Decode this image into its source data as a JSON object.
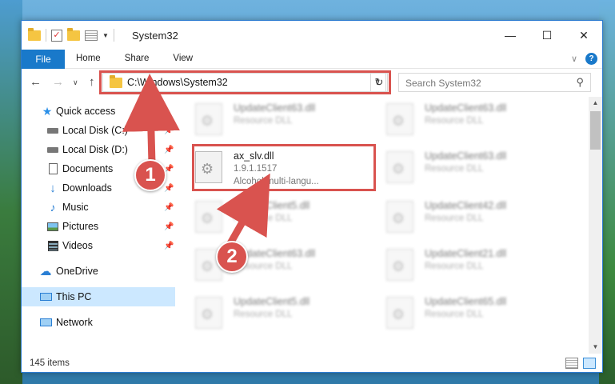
{
  "window": {
    "title": "System32",
    "controls": {
      "minimize": "—",
      "maximize": "☐",
      "close": "✕"
    }
  },
  "ribbon": {
    "file_tab": "File",
    "tabs": [
      "Home",
      "Share",
      "View"
    ]
  },
  "navigation": {
    "address": "C:\\Windows\\System32",
    "search_placeholder": "Search System32"
  },
  "sidebar": {
    "items": [
      {
        "label": "Quick access",
        "icon": "star-icon",
        "pinned": false
      },
      {
        "label": "Local Disk (C:)",
        "icon": "drive-icon",
        "pinned": true
      },
      {
        "label": "Local Disk (D:)",
        "icon": "drive-icon",
        "pinned": true
      },
      {
        "label": "Documents",
        "icon": "documents-icon",
        "pinned": true
      },
      {
        "label": "Downloads",
        "icon": "download-icon",
        "pinned": true
      },
      {
        "label": "Music",
        "icon": "music-icon",
        "pinned": true
      },
      {
        "label": "Pictures",
        "icon": "pictures-icon",
        "pinned": true
      },
      {
        "label": "Videos",
        "icon": "videos-icon",
        "pinned": true
      },
      {
        "label": "OneDrive",
        "icon": "cloud-icon",
        "pinned": false
      },
      {
        "label": "This PC",
        "icon": "computer-icon",
        "pinned": false,
        "selected": true
      },
      {
        "label": "Network",
        "icon": "network-icon",
        "pinned": false
      }
    ]
  },
  "files": {
    "highlighted": {
      "name": "ax_slv.dll",
      "version": "1.9.1.1517",
      "description": "Alcohol multi-langu..."
    },
    "blurred": [
      {
        "name": "UpdateClient63.dll",
        "type": "Resource DLL"
      },
      {
        "name": "UpdateClient63.dll",
        "type": "Resource DLL"
      },
      {
        "name": "UpdateClient63.dll",
        "type": "Resource DLL"
      },
      {
        "name": "UpdateClient5.dll",
        "type": "Resource DLL"
      },
      {
        "name": "UpdateClient42.dll",
        "type": "Resource DLL"
      },
      {
        "name": "UpdateClient63.dll",
        "type": "Resource DLL"
      },
      {
        "name": "UpdateClient21.dll",
        "type": "Resource DLL"
      },
      {
        "name": "UpdateClient5.dll",
        "type": "Resource DLL"
      },
      {
        "name": "UpdateClient65.dll",
        "type": "Resource DLL"
      }
    ]
  },
  "status": {
    "item_count": "145 items"
  },
  "annotations": {
    "step1": "1",
    "step2": "2",
    "color": "#d9534f"
  }
}
